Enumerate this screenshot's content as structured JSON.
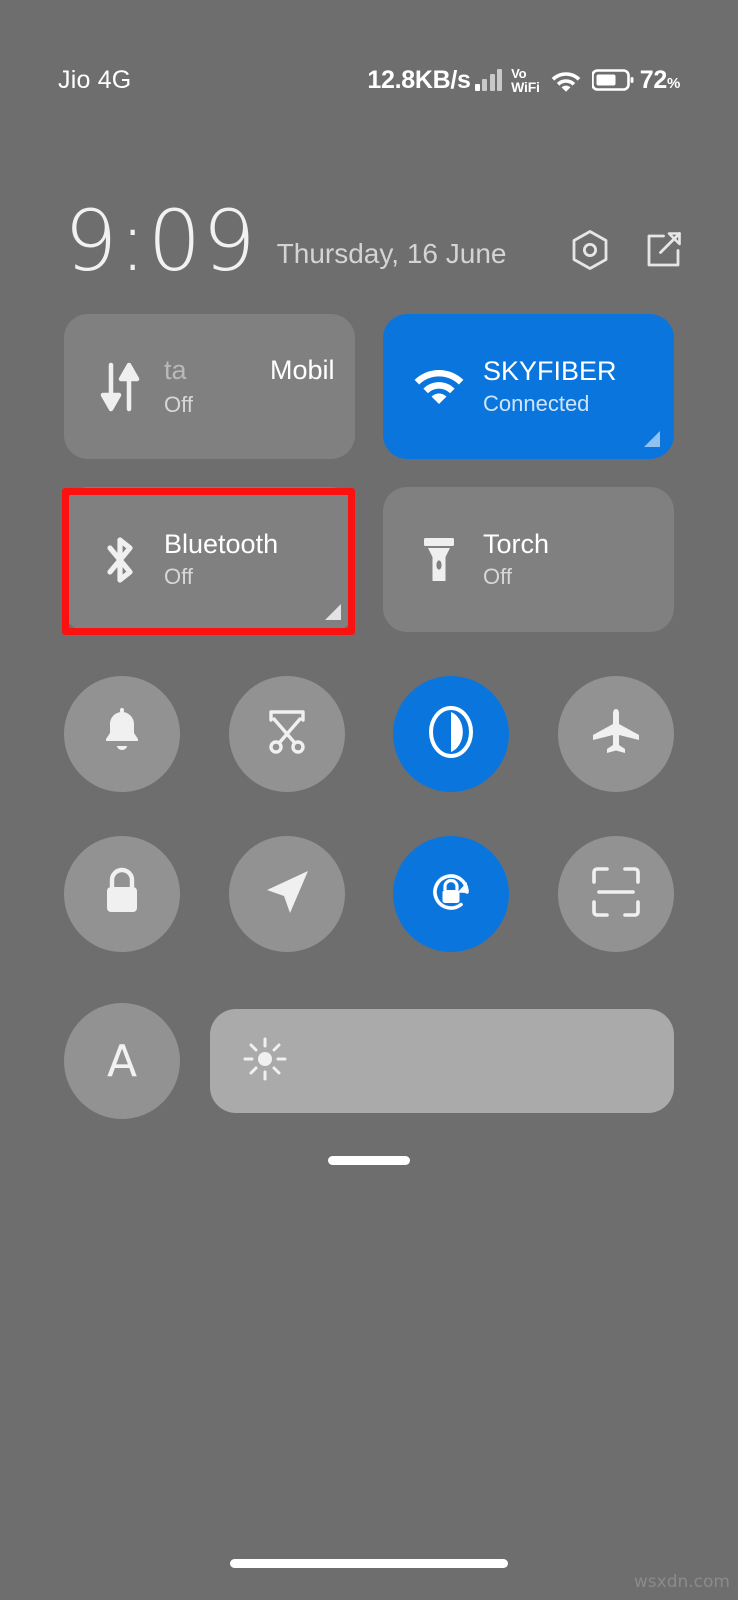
{
  "status_bar": {
    "carrier": "Jio 4G",
    "network_speed": "12.8KB/s",
    "volte_label_top": "Vo",
    "volte_label_bottom": "WiFi",
    "battery_percent": "72",
    "battery_percent_symbol": "%",
    "signal_icon": "signal-bars-icon",
    "wifi_icon": "wifi-icon",
    "battery_icon": "battery-icon"
  },
  "header": {
    "time": "9:09",
    "date": "Thursday, 16 June",
    "settings_icon": "settings-gear-icon",
    "edit_icon": "edit-pencil-icon"
  },
  "tiles": [
    {
      "name": "mobile-data",
      "title_outgoing": "ta",
      "title_incoming": "Mobil",
      "subtitle": "Off",
      "state": "inactive",
      "icon": "data-transfer-icon",
      "has_expand_corner": false
    },
    {
      "name": "wifi",
      "title": "SKYFIBER",
      "subtitle": "Connected",
      "state": "active",
      "icon": "wifi-icon",
      "has_expand_corner": true
    },
    {
      "name": "bluetooth",
      "title": "Bluetooth",
      "subtitle": "Off",
      "state": "inactive",
      "icon": "bluetooth-icon",
      "has_expand_corner": true,
      "highlighted": true
    },
    {
      "name": "torch",
      "title": "Torch",
      "subtitle": "Off",
      "state": "inactive",
      "icon": "flashlight-icon",
      "has_expand_corner": false
    }
  ],
  "quick_toggles_row1": [
    {
      "name": "silent-mode",
      "icon": "bell-icon",
      "state": "inactive"
    },
    {
      "name": "screenshot",
      "icon": "scissors-icon",
      "state": "inactive"
    },
    {
      "name": "dark-mode",
      "icon": "contrast-icon",
      "state": "active"
    },
    {
      "name": "airplane-mode",
      "icon": "airplane-icon",
      "state": "inactive"
    }
  ],
  "quick_toggles_row2": [
    {
      "name": "lock-screen",
      "icon": "lock-icon",
      "state": "inactive"
    },
    {
      "name": "location",
      "icon": "location-arrow-icon",
      "state": "inactive"
    },
    {
      "name": "rotation-lock",
      "icon": "rotation-lock-icon",
      "state": "active"
    },
    {
      "name": "scanner",
      "icon": "scan-frame-icon",
      "state": "inactive"
    }
  ],
  "brightness": {
    "auto_label": "A",
    "auto_icon": "auto-brightness-icon",
    "slider_icon": "sun-icon",
    "slider_fill_percent": 0
  },
  "footer": {
    "drag_handle": "panel-drag-handle",
    "nav_pill": "home-gesture-bar",
    "watermark": "wsxdn.com"
  },
  "colors": {
    "background": "#6e6e6e",
    "tile_inactive": "#808080",
    "tile_active": "#0a76dd",
    "circle_inactive": "#929292",
    "slider_track": "#abaaaa",
    "highlight_border": "#fc1111",
    "text_primary": "#ffffff",
    "text_secondary": "#d7d7d7"
  }
}
